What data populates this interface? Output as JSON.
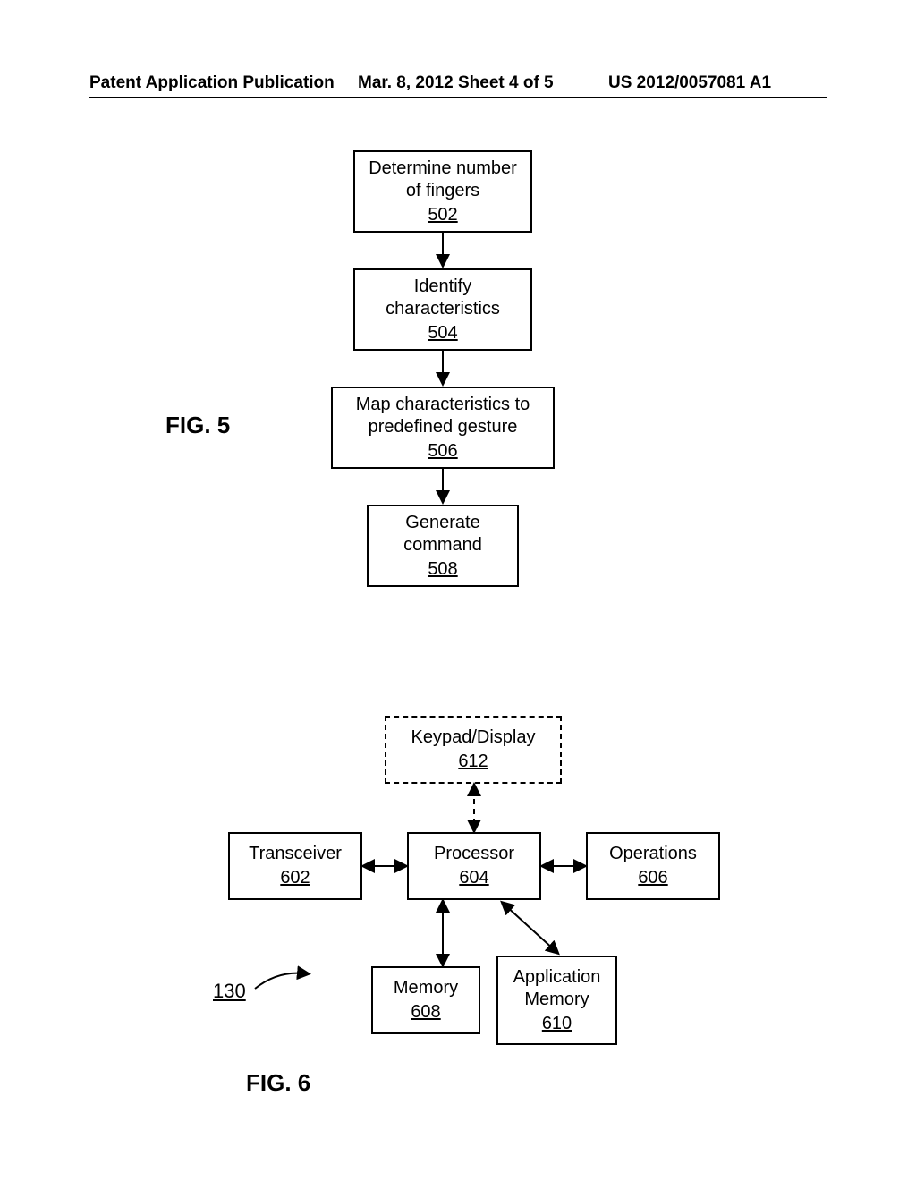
{
  "header": {
    "left": "Patent Application Publication",
    "middle": "Mar. 8, 2012  Sheet 4 of 5",
    "right": "US 2012/0057081 A1"
  },
  "fig5": {
    "label": "FIG. 5",
    "steps": [
      {
        "text": "Determine number of fingers",
        "ref": "502"
      },
      {
        "text": "Identify characteristics",
        "ref": "504"
      },
      {
        "text": "Map characteristics to predefined gesture",
        "ref": "506"
      },
      {
        "text": "Generate command",
        "ref": "508"
      }
    ]
  },
  "fig6": {
    "label": "FIG. 6",
    "ref": "130",
    "blocks": {
      "keypad": {
        "text": "Keypad/Display",
        "ref": "612"
      },
      "transceiver": {
        "text": "Transceiver",
        "ref": "602"
      },
      "processor": {
        "text": "Processor",
        "ref": "604"
      },
      "operations": {
        "text": "Operations",
        "ref": "606"
      },
      "memory": {
        "text": "Memory",
        "ref": "608"
      },
      "appmemory": {
        "text": "Application Memory",
        "ref": "610"
      }
    }
  }
}
